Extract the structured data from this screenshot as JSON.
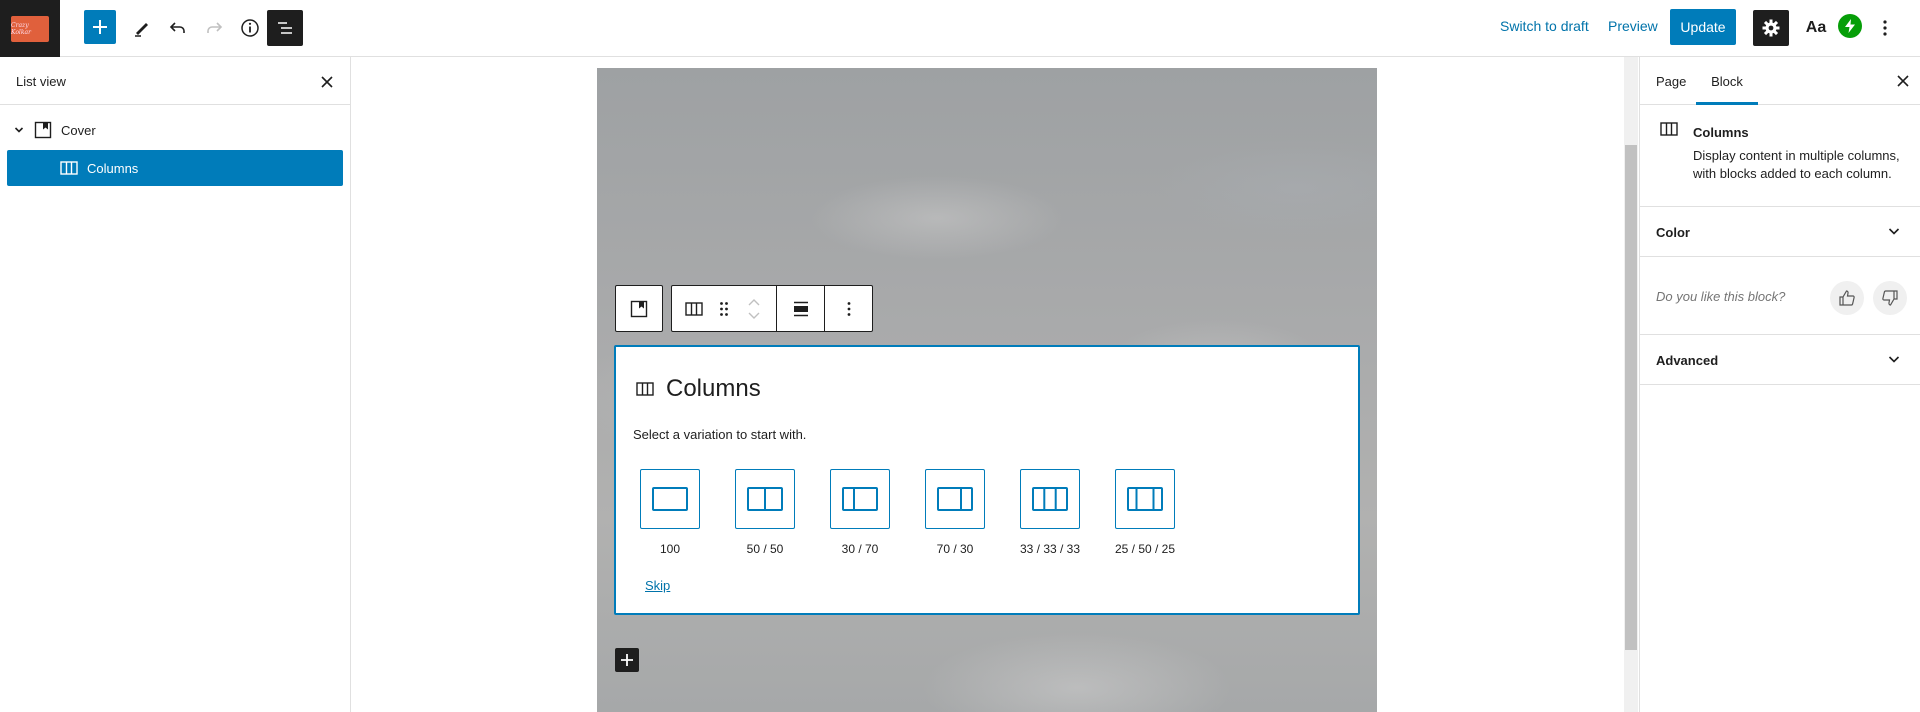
{
  "topbar": {
    "site_logo_text": "Crazy Kolkar",
    "switch_to_draft": "Switch to draft",
    "preview": "Preview",
    "update": "Update",
    "styles_label": "Aa"
  },
  "list_view": {
    "title": "List view",
    "items": [
      {
        "label": "Cover"
      },
      {
        "label": "Columns"
      }
    ]
  },
  "placeholder": {
    "title": "Columns",
    "instructions": "Select a variation to start with.",
    "variations": [
      {
        "label": "100"
      },
      {
        "label": "50 / 50"
      },
      {
        "label": "30 / 70"
      },
      {
        "label": "70 / 30"
      },
      {
        "label": "33 / 33 / 33"
      },
      {
        "label": "25 / 50 / 25"
      }
    ],
    "skip": "Skip"
  },
  "sidebar": {
    "tabs": [
      {
        "label": "Page"
      },
      {
        "label": "Block"
      }
    ],
    "active_tab": "Block",
    "block_card": {
      "title": "Columns",
      "description": "Display content in multiple columns, with blocks added to each column."
    },
    "panels": {
      "color": "Color",
      "feedback": "Do you like this block?",
      "advanced": "Advanced"
    }
  },
  "colors": {
    "accent": "#007cba",
    "dark": "#1e1e1e",
    "jetpack": "#069e08"
  }
}
